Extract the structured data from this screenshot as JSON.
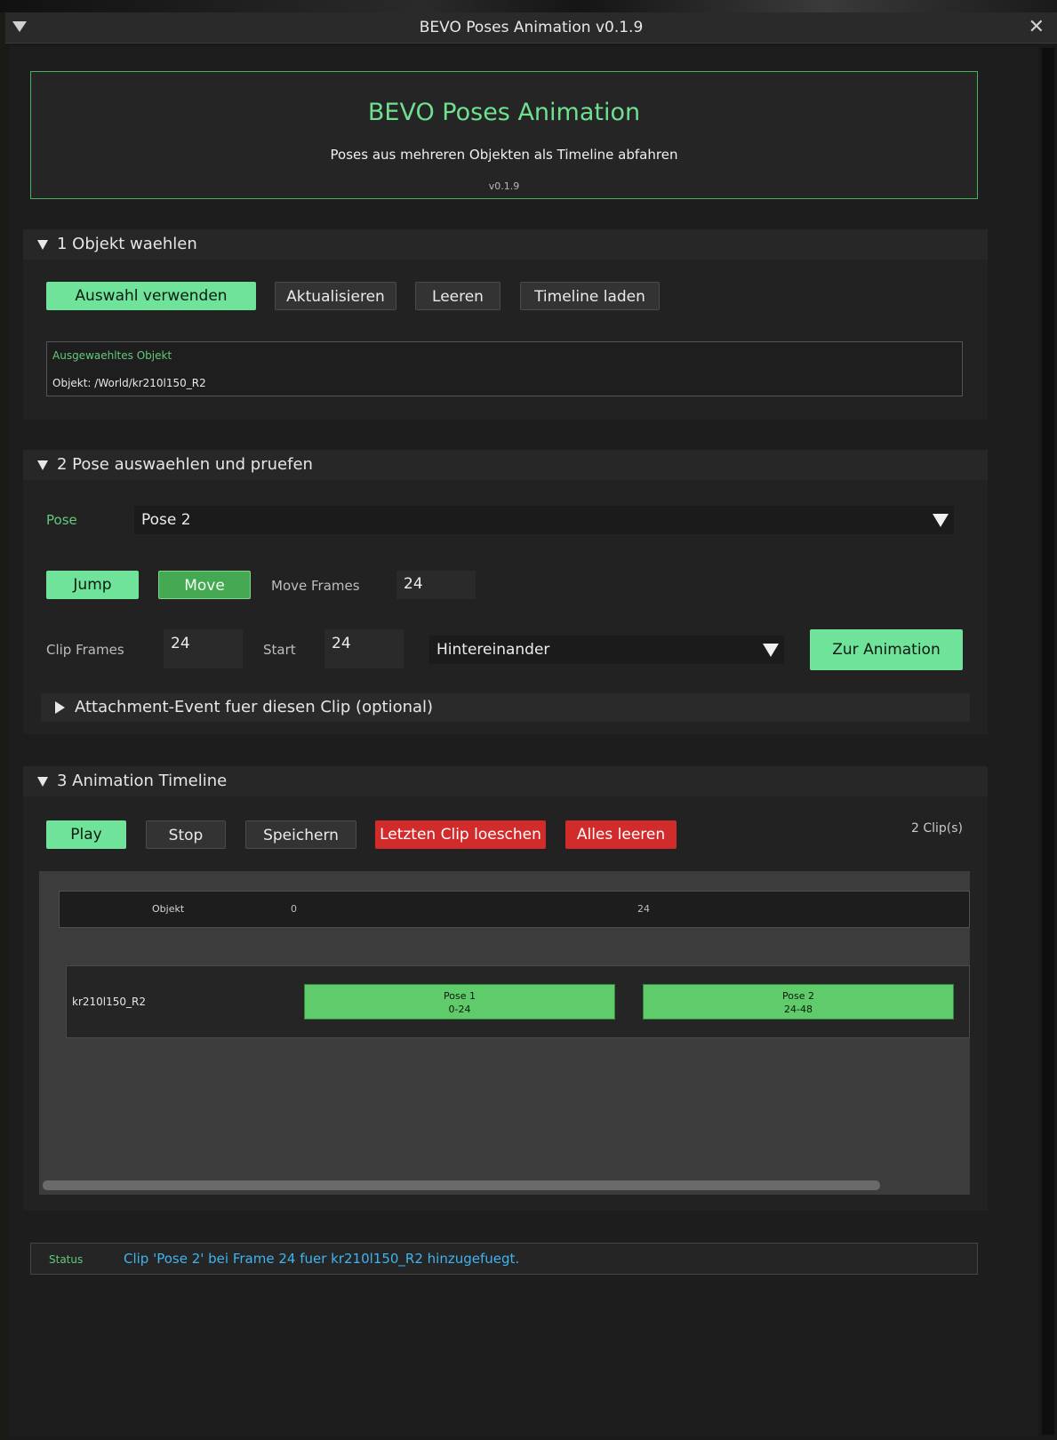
{
  "window": {
    "title": "BEVO Poses Animation v0.1.9"
  },
  "header": {
    "title": "BEVO Poses Animation",
    "subtitle": "Poses aus mehreren Objekten als Timeline abfahren",
    "version": "v0.1.9"
  },
  "section1": {
    "title": "1  Objekt waehlen",
    "buttons": {
      "use_selection": "Auswahl verwenden",
      "refresh": "Aktualisieren",
      "clear": "Leeren",
      "load_timeline": "Timeline laden"
    },
    "selected_label": "Ausgewaehltes Objekt",
    "selected_value": "Objekt: /World/kr210l150_R2"
  },
  "section2": {
    "title": "2  Pose auswaehlen und pruefen",
    "pose_label": "Pose",
    "pose_value": "Pose 2",
    "jump_label": "Jump",
    "move_label": "Move",
    "move_frames_label": "Move Frames",
    "move_frames_value": "24",
    "clip_frames_label": "Clip Frames",
    "clip_frames_value": "24",
    "start_label": "Start",
    "start_value": "24",
    "mode_value": "Hintereinander",
    "to_animation_label": "Zur Animation",
    "attachment_label": "Attachment-Event fuer diesen Clip (optional)"
  },
  "section3": {
    "title": "3  Animation Timeline",
    "buttons": {
      "play": "Play",
      "stop": "Stop",
      "save": "Speichern",
      "delete_last": "Letzten Clip loeschen",
      "clear_all": "Alles leeren"
    },
    "clip_count": "2 Clip(s)",
    "timeline": {
      "object_header": "Objekt",
      "ticks": [
        "0",
        "24"
      ],
      "rows": [
        {
          "object": "kr210l150_R2",
          "clips": [
            {
              "name": "Pose 1",
              "range": "0-24"
            },
            {
              "name": "Pose 2",
              "range": "24-48"
            }
          ]
        }
      ]
    }
  },
  "status": {
    "label": "Status",
    "message": "Clip 'Pose 2' bei Frame 24 fuer kr210l150_R2 hinzugefuegt."
  },
  "colors": {
    "accent_green": "#6fe39a",
    "danger_red": "#d22b2b",
    "status_blue": "#3fb4f0",
    "header_border": "#47b35a"
  }
}
